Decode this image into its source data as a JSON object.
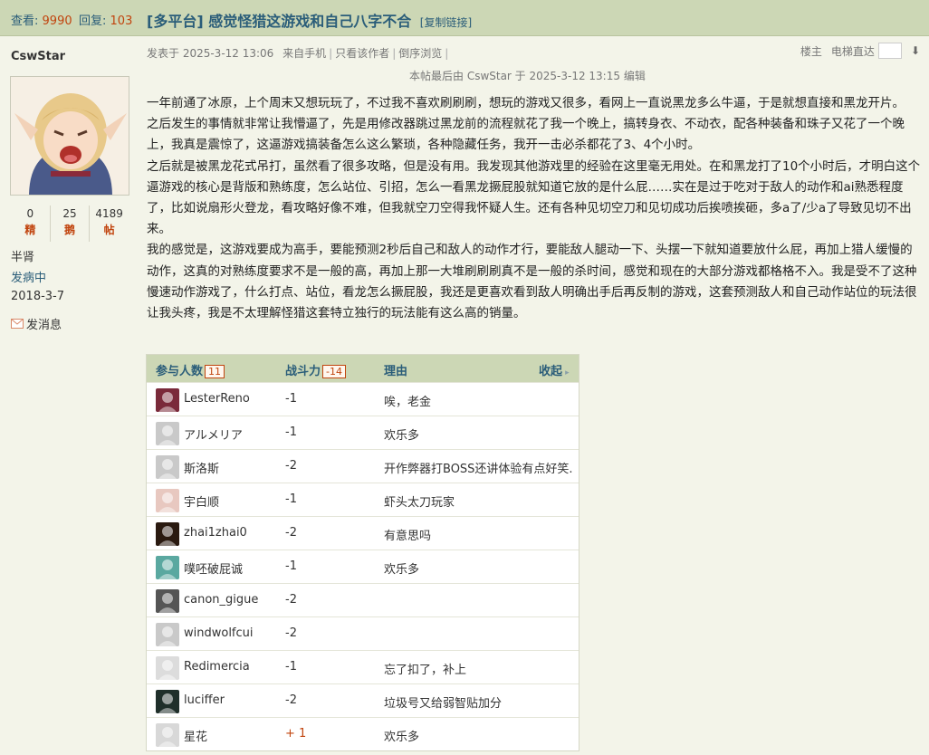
{
  "header": {
    "views_label": "查看:",
    "views_value": "9990",
    "replies_label": "回复:",
    "replies_value": "103",
    "title": "[多平台] 感觉怪猎这游戏和自己八字不合",
    "copy_link": "[复制链接]"
  },
  "author": {
    "name": "CswStar",
    "stats": [
      {
        "value": "0",
        "label": "精"
      },
      {
        "value": "25",
        "label": "鹅"
      },
      {
        "value": "4189",
        "label": "帖"
      }
    ],
    "rank": "半肾",
    "group": "发病中",
    "reg_date": "2018-3-7",
    "message": "发消息"
  },
  "post_meta": {
    "posted": "发表于 2025-3-12 13:06",
    "source": "来自手机",
    "only_author": "只看该作者",
    "reverse": "倒序浏览",
    "floor": "楼主",
    "elevator": "电梯直达",
    "edited": "本帖最后由 CswStar 于 2025-3-12 13:15 编辑"
  },
  "content": [
    "一年前通了冰原，上个周末又想玩玩了，不过我不喜欢刷刷刷，想玩的游戏又很多，看网上一直说黑龙多么牛逼，于是就想直接和黑龙开片。",
    "之后发生的事情就非常让我懵逼了，先是用修改器跳过黑龙前的流程就花了我一个晚上，搞转身衣、不动衣，配各种装备和珠子又花了一个晚上，我真是震惊了，这逼游戏搞装备怎么这么繁琐，各种隐藏任务，我开一击必杀都花了3、4个小时。",
    "之后就是被黑龙花式吊打，虽然看了很多攻略，但是没有用。我发现其他游戏里的经验在这里毫无用处。在和黑龙打了10个小时后，才明白这个逼游戏的核心是背版和熟练度，怎么站位、引招，怎么一看黑龙撅屁股就知道它放的是什么屁……实在是过于吃对于敌人的动作和ai熟悉程度了，比如说扇形火登龙，看攻略好像不难，但我就空刀空得我怀疑人生。还有各种见切空刀和见切成功后挨喷挨砸，多a了/少a了导致见切不出来。",
    "我的感觉是，这游戏要成为高手，要能预测2秒后自己和敌人的动作才行，要能敌人腿动一下、头摆一下就知道要放什么屁，再加上猎人缓慢的动作，这真的对熟练度要求不是一般的高，再加上那一大堆刷刷刷真不是一般的杀时间，感觉和现在的大部分游戏都格格不入。我是受不了这种慢速动作游戏了，什么打点、站位，看龙怎么撅屁股，我还是更喜欢看到敌人明确出手后再反制的游戏，这套预测敌人和自己动作站位的玩法很让我头疼，我是不太理解怪猎这套特立独行的玩法能有这么高的销量。"
  ],
  "rating": {
    "col_participants": "参与人数",
    "participants_count": "11",
    "col_score": "战斗力",
    "score_total": "-14",
    "col_reason": "理由",
    "collapse": "收起",
    "rows": [
      {
        "name": "LesterReno",
        "score": "-1",
        "reason": "唉，老金",
        "avatar_color": "#7a2a3a"
      },
      {
        "name": "アルメリア",
        "score": "-1",
        "reason": "欢乐多",
        "avatar_color": "#c9c9c9"
      },
      {
        "name": "斯洛斯",
        "score": "-2",
        "reason": "开作弊器打BOSS还讲体验有点好笑.",
        "avatar_color": "#c9c9c9"
      },
      {
        "name": "宇白顺",
        "score": "-1",
        "reason": "虾头太刀玩家",
        "avatar_color": "#e8c8c0"
      },
      {
        "name": "zhai1zhai0",
        "score": "-2",
        "reason": "有意思吗",
        "avatar_color": "#2a1a10"
      },
      {
        "name": "噗呸破屁诚",
        "score": "-1",
        "reason": "欢乐多",
        "avatar_color": "#5aa8a0"
      },
      {
        "name": "canon_gigue",
        "score": "-2",
        "reason": "",
        "avatar_color": "#555555"
      },
      {
        "name": "windwolfcui",
        "score": "-2",
        "reason": "",
        "avatar_color": "#c9c9c9"
      },
      {
        "name": "Redimercia",
        "score": "-1",
        "reason": "忘了扣了，补上",
        "avatar_color": "#dcdcdc"
      },
      {
        "name": "luciffer",
        "score": "-2",
        "reason": "垃圾号又给弱智贴加分",
        "avatar_color": "#1f2f2a"
      },
      {
        "name": "星花",
        "score": "+ 1",
        "reason": "欢乐多",
        "avatar_color": "#d8d8d8"
      }
    ]
  }
}
